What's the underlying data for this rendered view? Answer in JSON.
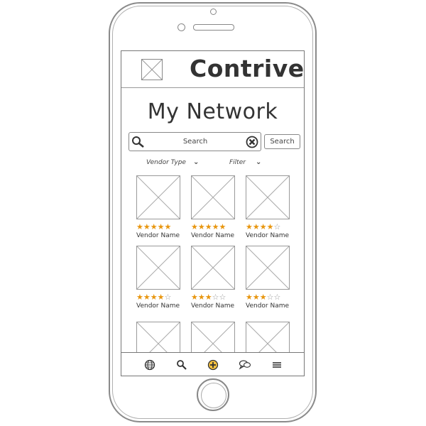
{
  "header": {
    "app_title": "Contrive"
  },
  "page": {
    "title": "My Network"
  },
  "search": {
    "placeholder": "Search",
    "button_label": "Search"
  },
  "filters": {
    "vendor_type_label": "Vendor Type",
    "filter_label": "Filter"
  },
  "vendors": [
    {
      "name": "Vendor Name",
      "rating": 5,
      "max": 5
    },
    {
      "name": "Vendor Name",
      "rating": 5,
      "max": 5
    },
    {
      "name": "Vendor Name",
      "rating": 4,
      "max": 5
    },
    {
      "name": "Vendor Name",
      "rating": 4,
      "max": 5
    },
    {
      "name": "Vendor Name",
      "rating": 3,
      "max": 5
    },
    {
      "name": "Vendor Name",
      "rating": 3,
      "max": 5
    },
    {
      "name": "",
      "rating": 0,
      "max": 0
    },
    {
      "name": "",
      "rating": 0,
      "max": 0
    },
    {
      "name": "",
      "rating": 0,
      "max": 0
    }
  ],
  "tabbar": {
    "items": [
      {
        "icon": "globe-icon"
      },
      {
        "icon": "search-icon"
      },
      {
        "icon": "add-icon",
        "color": "#e8a010"
      },
      {
        "icon": "chat-icon"
      },
      {
        "icon": "menu-icon"
      }
    ]
  },
  "colors": {
    "star": "#e8960f",
    "accent": "#e8a010"
  }
}
